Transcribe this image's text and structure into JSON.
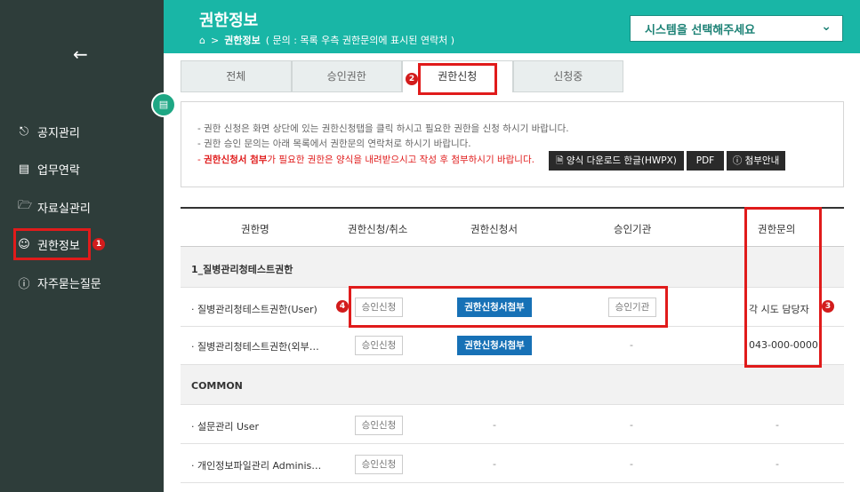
{
  "sidebar": {
    "back_icon": "arrow-left-icon",
    "items": [
      {
        "label": "공지관리",
        "icon": "bell-icon"
      },
      {
        "label": "업무연락",
        "icon": "document-icon"
      },
      {
        "label": "자료실관리",
        "icon": "folder-icon"
      },
      {
        "label": "권한정보",
        "icon": "user-icon"
      },
      {
        "label": "자주묻는질문",
        "icon": "question-icon"
      }
    ],
    "toggle_icon": "note-icon"
  },
  "header": {
    "title": "권한정보",
    "breadcrumb_home_icon": "home-icon",
    "breadcrumb_sep": ">",
    "breadcrumb_current": "권한정보",
    "breadcrumb_note": "( 문의 : 목록 우측 권한문의에 표시된 연락처 )",
    "system_select": "시스템을 선택해주세요"
  },
  "tabs": [
    {
      "label": "전체"
    },
    {
      "label": "승인권한"
    },
    {
      "label": "권한신청"
    },
    {
      "label": "신청중"
    }
  ],
  "info": {
    "line1": "- 권한 신청은 화면 상단에 있는 권한신청탭을 클릭 하시고 필요한 권한을 신청 하시기 바랍니다.",
    "line2": "- 권한 승인 문의는 아래 목록에서 권한문의 연락처로 하시기 바랍니다.",
    "line3_prefix": "- ",
    "line3_bold": "권한신청서 첨부",
    "line3_rest": "가 필요한 권한은 양식을 내려받으시고 작성 후 첨부하시기 바랍니다.",
    "btn_download": "양식 다운로드 한글(HWPX)",
    "btn_pdf": "PDF",
    "btn_guide": "첨부안내"
  },
  "table": {
    "headers": [
      "권한명",
      "권한신청/취소",
      "권한신청서",
      "승인기관",
      "권한문의"
    ],
    "groups": [
      {
        "name": "1_질병관리청테스트권한",
        "rows": [
          {
            "name": "· 질병관리청테스트권한(User)",
            "apply": "승인신청",
            "form": "권한신청서첨부",
            "org": "승인기관",
            "contact": "각 시도 담당자"
          },
          {
            "name": "· 질병관리청테스트권한(외부…",
            "apply": "승인신청",
            "form": "권한신청서첨부",
            "org": "-",
            "contact": "043-000-0000"
          }
        ]
      },
      {
        "name": "COMMON",
        "rows": [
          {
            "name": "· 설문관리 User",
            "apply": "승인신청",
            "form": "-",
            "org": "-",
            "contact": "-"
          },
          {
            "name": "· 개인정보파일관리 Adminis…",
            "apply": "승인신청",
            "form": "-",
            "org": "-",
            "contact": "-"
          }
        ]
      }
    ]
  },
  "badges": [
    "1",
    "2",
    "3",
    "4"
  ],
  "colors": {
    "sidebar": "#2e3d3a",
    "header": "#19b6a6",
    "accent_blue": "#1771b6",
    "highlight_red": "#e01b1b"
  }
}
